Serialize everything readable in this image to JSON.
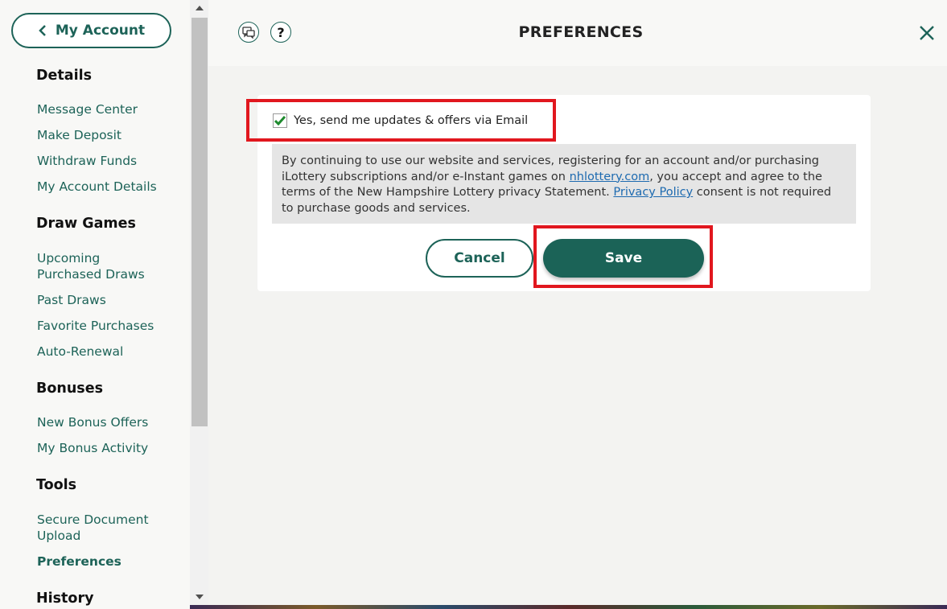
{
  "sidebar": {
    "back_label": "My Account",
    "sections": [
      {
        "title": "Details",
        "items": [
          "Message Center",
          "Make Deposit",
          "Withdraw Funds",
          "My Account Details"
        ]
      },
      {
        "title": "Draw Games",
        "items": [
          "Upcoming Purchased Draws",
          "Past Draws",
          "Favorite Purchases",
          "Auto-Renewal"
        ]
      },
      {
        "title": "Bonuses",
        "items": [
          "New Bonus Offers",
          "My Bonus Activity"
        ]
      },
      {
        "title": "Tools",
        "items": [
          "Secure Document Upload",
          "Preferences"
        ]
      },
      {
        "title": "History",
        "items": []
      }
    ],
    "active_item": "Preferences"
  },
  "header": {
    "title": "PREFERENCES",
    "help_symbol": "?",
    "icons": [
      "chat-icon",
      "help-icon",
      "close-icon"
    ]
  },
  "preferences": {
    "email_opt_label": "Yes, send me updates & offers via Email",
    "email_opt_checked": true,
    "disclaimer": {
      "part1": "By continuing to use our website and services, registering for an account and/or purchasing iLottery subscriptions and/or e-Instant games on ",
      "link1": "nhlottery.com",
      "part2": ", you accept and agree to the terms of the New Hampshire Lottery privacy Statement. ",
      "link2": "Privacy Policy",
      "part3": " consent is not required to purchase goods and services."
    },
    "cancel_label": "Cancel",
    "save_label": "Save"
  },
  "colors": {
    "brand_green": "#1d6358",
    "highlight_red": "#e1171e",
    "link_blue": "#1d6ab0",
    "check_green": "#1e8a2e"
  }
}
